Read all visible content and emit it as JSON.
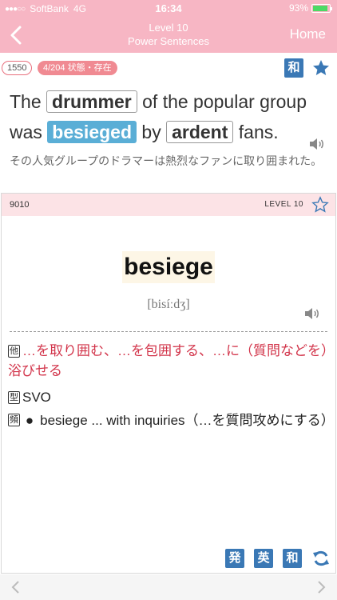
{
  "status": {
    "carrier": "SoftBank",
    "network": "4G",
    "time": "16:34",
    "battery": "93%",
    "battery_level": 0.93
  },
  "nav": {
    "title_line1": "Level 10",
    "title_line2": "Power Sentences",
    "home_label": "Home"
  },
  "meta": {
    "number": "1550",
    "category": "4/204  状態・存在",
    "wa_label": "和"
  },
  "sentence": {
    "w1": "The",
    "k1": "drummer",
    "w2": "of the popular group",
    "w3": "was",
    "k2": "besieged",
    "w4": "by",
    "k3": "ardent",
    "w5": "fans."
  },
  "translation": "その人気グループのドラマーは熱烈なファンに取り囲まれた。",
  "card": {
    "number": "9010",
    "level": "LEVEL 10",
    "headword": "besiege",
    "pronunciation": "[bisíːdʒ]",
    "pos_badge": "他",
    "definition": "…を取り囲む、…を包囲する、…に（質問などを）浴びせる",
    "pattern_badge": "型",
    "pattern": "SVO",
    "example_badge": "頻",
    "example_bullet": "●",
    "example": "besiege ... with inquiries（…を質問攻めにする）",
    "btn_pron": "発",
    "btn_en": "英",
    "btn_ja": "和"
  },
  "colors": {
    "header_pink": "#f7b6c4",
    "accent_blue": "#3a78b5",
    "highlight": "#5aaed6",
    "definition_red": "#d2344a"
  }
}
